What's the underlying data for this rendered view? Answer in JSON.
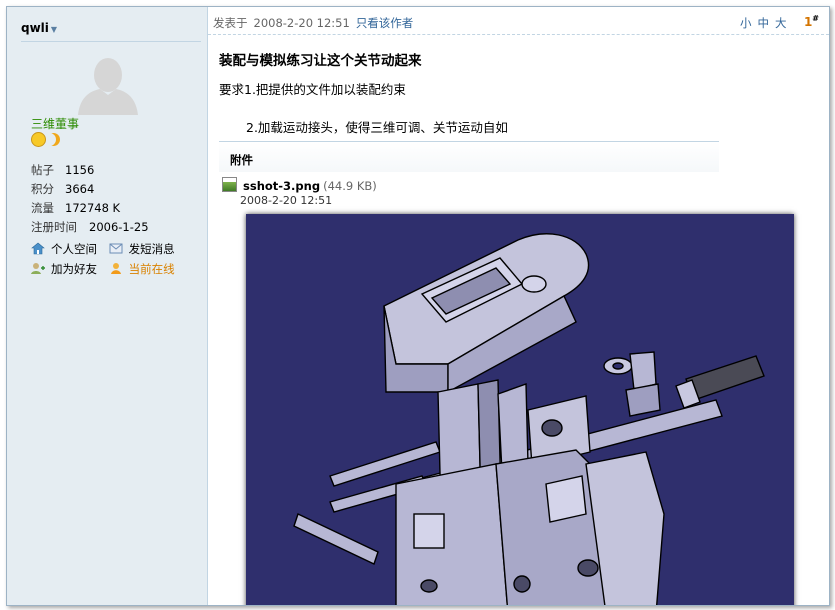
{
  "user": {
    "name": "qwli",
    "rank": "三维董事",
    "stats": [
      {
        "label": "帖子",
        "value": "1156"
      },
      {
        "label": "积分",
        "value": "3664"
      },
      {
        "label": "流量",
        "value": "172748 K"
      },
      {
        "label": "注册时间",
        "value": "2006-1-25"
      }
    ],
    "links": {
      "space": "个人空间",
      "message": "发短消息",
      "add_friend": "加为好友",
      "online": "当前在线"
    }
  },
  "post": {
    "posted_label": "发表于",
    "posted_time": "2008-2-20 12:51",
    "author_only": "只看该作者",
    "font_sizes": [
      "小",
      "中",
      "大"
    ],
    "floor": "1",
    "floor_sup": "#",
    "title": "装配与模拟练习让这个关节动起来",
    "lines": [
      "要求1.把提供的文件加以装配约束",
      "2.加载运动接头，使得三维可调、关节运动自如"
    ],
    "attachment": {
      "header": "附件",
      "filename": "sshot-3.png",
      "size": "(44.9 KB)",
      "date": "2008-2-20 12:51"
    }
  },
  "colors": {
    "sidebar_bg": "#e5edf2",
    "border": "#c2d5e3",
    "link": "#336699",
    "rank": "#2a8a00",
    "online": "#d98200",
    "render_bg": "#2f2f6d",
    "part": "#b7b7d4"
  }
}
